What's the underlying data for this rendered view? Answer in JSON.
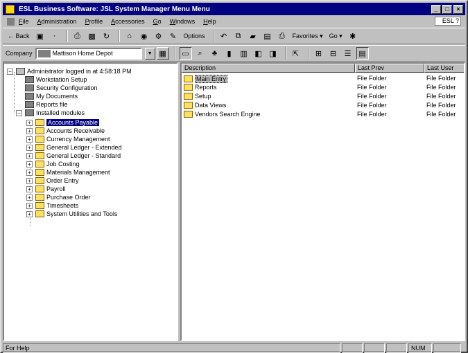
{
  "title": "ESL Business Software: JSL System Manager Menu Menu",
  "menu": [
    "File",
    "Administration",
    "Profile",
    "Accessories",
    "Go",
    "Windows",
    "Help"
  ],
  "help_box": "ESL ?",
  "toolbar1": {
    "back": "Back",
    "options": "Options",
    "favorites": "Favorites",
    "go": "Go"
  },
  "company": {
    "label": "Company",
    "value": "Mattison Home Depot"
  },
  "tree": {
    "root": "Administrator logged in at 4:58:18 PM",
    "items": [
      "Workstation Setup",
      "Security Configuration",
      "My Documents",
      "Reports file",
      "Installed modules",
      "Accounts Payable",
      "Accounts Receivable",
      "Currency Management",
      "General Ledger - Extended",
      "General Ledger - Standard",
      "Job Costing",
      "Materials Management",
      "Order Entry",
      "Payroll",
      "Purchase Order",
      "Timesheets",
      "System Utilities and Tools"
    ]
  },
  "list": {
    "columns": [
      "Description",
      "Last Prev",
      "Last User"
    ],
    "rows": [
      {
        "name": "Main Entry",
        "type": "File Folder",
        "type2": "File Folder"
      },
      {
        "name": "Reports",
        "type": "File Folder",
        "type2": "File Folder"
      },
      {
        "name": "Setup",
        "type": "File Folder",
        "type2": "File Folder"
      },
      {
        "name": "Data Views",
        "type": "File Folder",
        "type2": "File Folder"
      },
      {
        "name": "Vendors Search Engine",
        "type": "File Folder",
        "type2": "File Folder"
      }
    ]
  },
  "status": {
    "left": "For Help",
    "num": "NUM"
  }
}
